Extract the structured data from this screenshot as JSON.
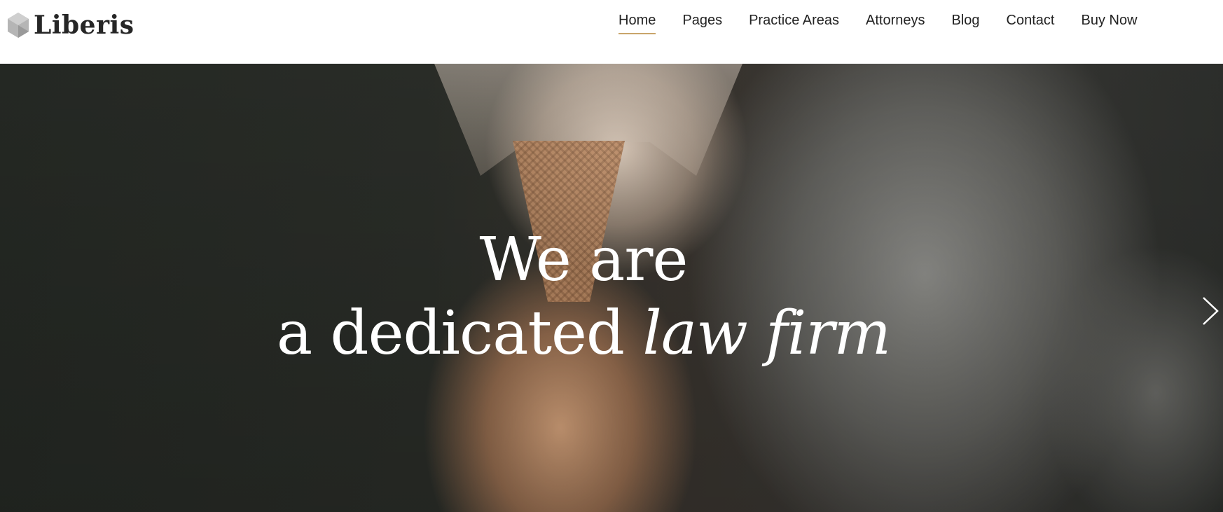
{
  "brand": {
    "name": "Liberis",
    "mark_color": "#a7a7a7"
  },
  "nav": {
    "items": [
      {
        "label": "Home",
        "active": true
      },
      {
        "label": "Pages"
      },
      {
        "label": "Practice Areas"
      },
      {
        "label": "Attorneys"
      },
      {
        "label": "Blog"
      },
      {
        "label": "Contact"
      },
      {
        "label": "Buy Now"
      }
    ],
    "active_underline_color": "#c9a56a"
  },
  "hero": {
    "line1": "We are",
    "line2_plain": "a dedicated ",
    "line2_emphasis": "law firm",
    "next_icon": "chevron-right-icon"
  }
}
